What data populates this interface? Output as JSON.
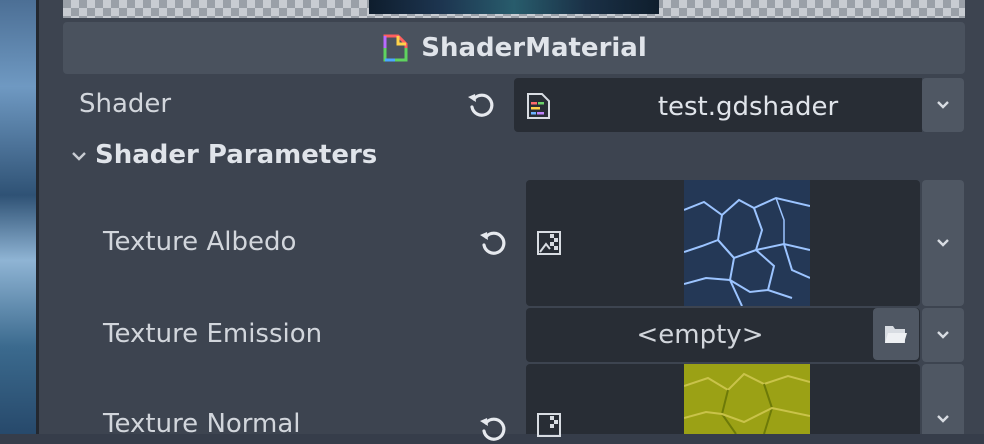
{
  "material": {
    "title": "ShaderMaterial",
    "icon": "shader-material-icon"
  },
  "shader": {
    "label": "Shader",
    "value": "test.gdshader",
    "icon": "shader-file-icon",
    "reset_icon": "reload-icon"
  },
  "section": {
    "title": "Shader Parameters",
    "icon": "chevron-down-icon"
  },
  "params": [
    {
      "label": "Texture Albedo",
      "thumbnail": "blue-cracked-rock-texture"
    },
    {
      "label": "Texture Emission",
      "value": "<empty>",
      "button_icon": "folder-icon"
    },
    {
      "label": "Texture Normal",
      "thumbnail": "yellow-normal-map-texture"
    }
  ],
  "colors": {
    "panel": "#3d4450",
    "field": "#282d35",
    "button": "#4f5763",
    "header": "#4a525e",
    "text": "#d2d6dc"
  }
}
